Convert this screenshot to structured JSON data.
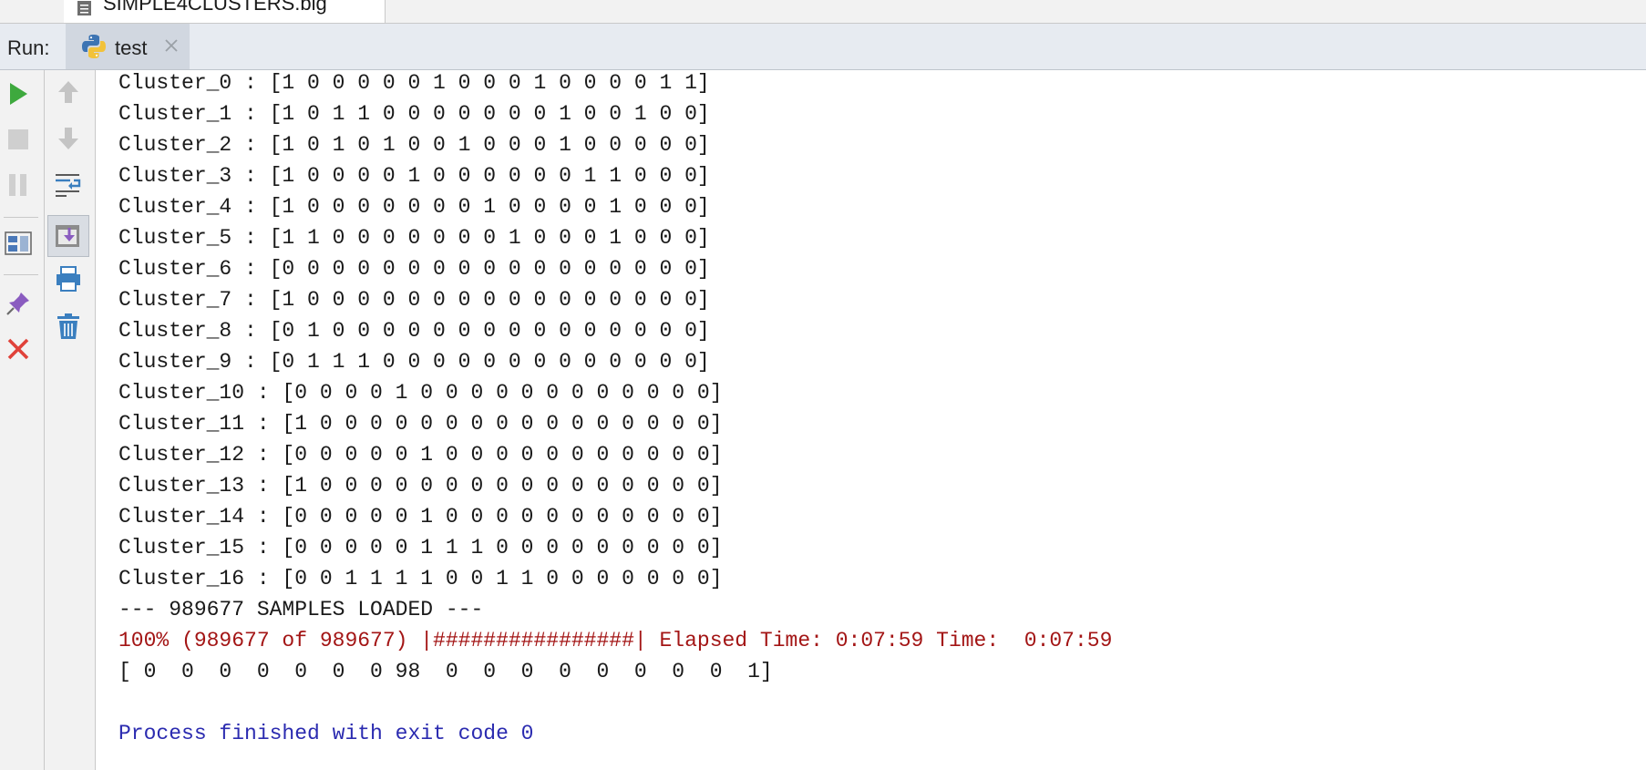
{
  "editor_tab": {
    "filename": "SIMPLE4CLUSTERS.big",
    "icon": "text-file-icon"
  },
  "run_panel": {
    "label": "Run:",
    "tab_name": "test",
    "tab_icon": "python-icon",
    "close_icon": "close-icon"
  },
  "toolbar_left": [
    {
      "name": "rerun-icon",
      "color": "#3ea93e"
    },
    {
      "name": "stop-icon",
      "color": "#c9c9c9"
    },
    {
      "name": "pause-icon",
      "color": "#c9c9c9"
    },
    {
      "name": "restore-layout-icon",
      "color": "#4a78b8"
    },
    {
      "name": "pin-tab-icon",
      "color": "#8a5cc0"
    },
    {
      "name": "close-run-icon",
      "color": "#e0423a"
    }
  ],
  "toolbar_right": [
    {
      "name": "up-stack-icon",
      "color": "#b9b9b9"
    },
    {
      "name": "down-stack-icon",
      "color": "#b9b9b9"
    },
    {
      "name": "soft-wrap-icon",
      "color": "#3b7fbf"
    },
    {
      "name": "scroll-to-end-icon",
      "color": "#8a5cc0"
    },
    {
      "name": "print-icon",
      "color": "#3b7fbf"
    },
    {
      "name": "clear-all-icon",
      "color": "#3b7fbf"
    }
  ],
  "console": {
    "lines": [
      {
        "text": "Cluster_0 : [1 0 0 0 0 0 1 0 0 0 1 0 0 0 0 1 1]",
        "style": "normal"
      },
      {
        "text": "Cluster_1 : [1 0 1 1 0 0 0 0 0 0 0 1 0 0 1 0 0]",
        "style": "normal"
      },
      {
        "text": "Cluster_2 : [1 0 1 0 1 0 0 1 0 0 0 1 0 0 0 0 0]",
        "style": "normal"
      },
      {
        "text": "Cluster_3 : [1 0 0 0 0 1 0 0 0 0 0 0 1 1 0 0 0]",
        "style": "normal"
      },
      {
        "text": "Cluster_4 : [1 0 0 0 0 0 0 0 1 0 0 0 0 1 0 0 0]",
        "style": "normal"
      },
      {
        "text": "Cluster_5 : [1 1 0 0 0 0 0 0 0 1 0 0 0 1 0 0 0]",
        "style": "normal"
      },
      {
        "text": "Cluster_6 : [0 0 0 0 0 0 0 0 0 0 0 0 0 0 0 0 0]",
        "style": "normal"
      },
      {
        "text": "Cluster_7 : [1 0 0 0 0 0 0 0 0 0 0 0 0 0 0 0 0]",
        "style": "normal"
      },
      {
        "text": "Cluster_8 : [0 1 0 0 0 0 0 0 0 0 0 0 0 0 0 0 0]",
        "style": "normal"
      },
      {
        "text": "Cluster_9 : [0 1 1 1 0 0 0 0 0 0 0 0 0 0 0 0 0]",
        "style": "normal"
      },
      {
        "text": "Cluster_10 : [0 0 0 0 1 0 0 0 0 0 0 0 0 0 0 0 0]",
        "style": "normal"
      },
      {
        "text": "Cluster_11 : [1 0 0 0 0 0 0 0 0 0 0 0 0 0 0 0 0]",
        "style": "normal"
      },
      {
        "text": "Cluster_12 : [0 0 0 0 0 1 0 0 0 0 0 0 0 0 0 0 0]",
        "style": "normal"
      },
      {
        "text": "Cluster_13 : [1 0 0 0 0 0 0 0 0 0 0 0 0 0 0 0 0]",
        "style": "normal"
      },
      {
        "text": "Cluster_14 : [0 0 0 0 0 1 0 0 0 0 0 0 0 0 0 0 0]",
        "style": "normal"
      },
      {
        "text": "Cluster_15 : [0 0 0 0 0 1 1 1 0 0 0 0 0 0 0 0 0]",
        "style": "normal"
      },
      {
        "text": "Cluster_16 : [0 0 1 1 1 1 0 0 1 1 0 0 0 0 0 0 0]",
        "style": "normal"
      },
      {
        "text": "--- 989677 SAMPLES LOADED ---",
        "style": "normal"
      },
      {
        "text": "100% (989677 of 989677) |################| Elapsed Time: 0:07:59 Time:  0:07:59",
        "style": "stderr"
      },
      {
        "text": "[ 0  0  0  0  0  0  0 98  0  0  0  0  0  0  0  0  1]",
        "style": "normal"
      },
      {
        "text": "",
        "style": "normal"
      },
      {
        "text": "Process finished with exit code 0",
        "style": "system"
      }
    ]
  }
}
